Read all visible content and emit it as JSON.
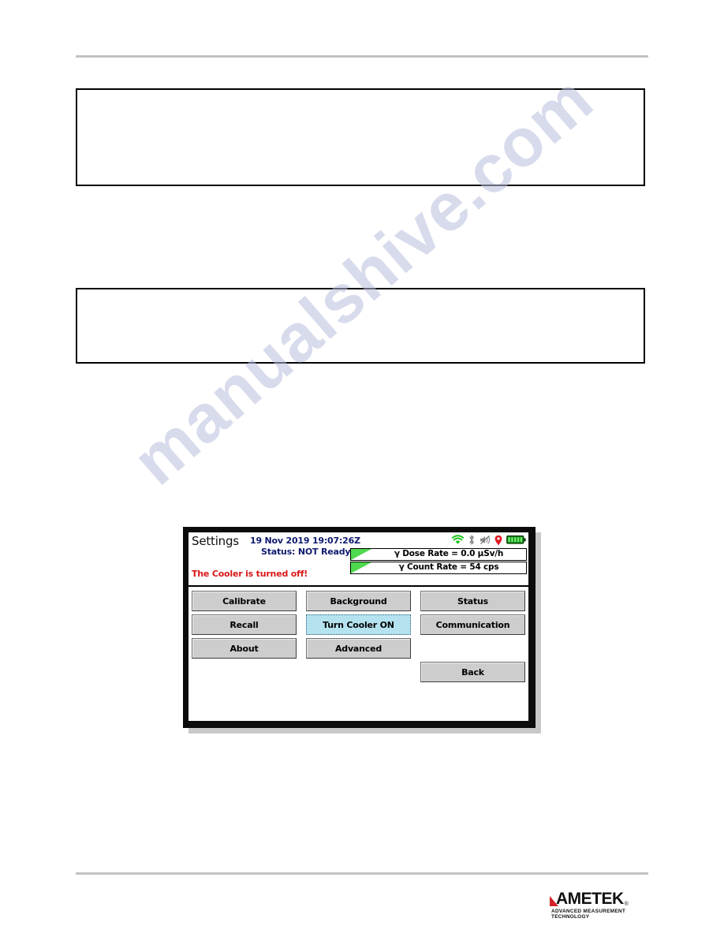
{
  "page": {
    "watermark_text": "manualshive.com"
  },
  "note_boxes": [
    {
      "id": "note-box-1",
      "text": ""
    },
    {
      "id": "note-box-2",
      "text": ""
    }
  ],
  "device": {
    "screen": {
      "title": "Settings",
      "datetime": "19 Nov 2019 19:07:26Z",
      "status_line": "Status: NOT Ready",
      "alert_message": "The Cooler is turned off!",
      "status_icons": [
        {
          "name": "wifi-icon",
          "color": "#1fc41f",
          "label": "wifi"
        },
        {
          "name": "bluetooth-icon",
          "color": "#8a8a8a",
          "label": "bluetooth"
        },
        {
          "name": "speaker-muted-icon",
          "color": "#8a8a8a",
          "label": "sound muted"
        },
        {
          "name": "location-pin-icon",
          "color": "#e01b24",
          "label": "gps location"
        },
        {
          "name": "battery-icon",
          "color": "#1fc41f",
          "label": "battery full"
        }
      ],
      "rate_panel": [
        {
          "label": "γ Dose Rate = 0.0  µSv/h",
          "quantity": "Dose Rate",
          "value": "0.0",
          "unit": "µSv/h",
          "bar_color": "#4ed94e"
        },
        {
          "label": "γ Count Rate = 54 cps",
          "quantity": "Count Rate",
          "value": "54",
          "unit": "cps",
          "bar_color": "#4ed94e"
        }
      ],
      "buttons": [
        {
          "label": "Calibrate",
          "selected": false
        },
        {
          "label": "Background",
          "selected": false
        },
        {
          "label": "Status",
          "selected": false
        },
        {
          "label": "Recall",
          "selected": false
        },
        {
          "label": "Turn Cooler ON",
          "selected": true
        },
        {
          "label": "Communication",
          "selected": false
        },
        {
          "label": "About",
          "selected": false
        },
        {
          "label": "Advanced",
          "selected": false
        },
        {
          "label": "",
          "selected": false
        },
        {
          "label": "",
          "selected": false
        },
        {
          "label": "",
          "selected": false
        },
        {
          "label": "Back",
          "selected": false
        }
      ]
    }
  },
  "footer": {
    "brand": "AMETEK",
    "registered_mark": "®",
    "tagline": "ADVANCED MEASUREMENT TECHNOLOGY",
    "brand_accent": "#d2232a"
  }
}
